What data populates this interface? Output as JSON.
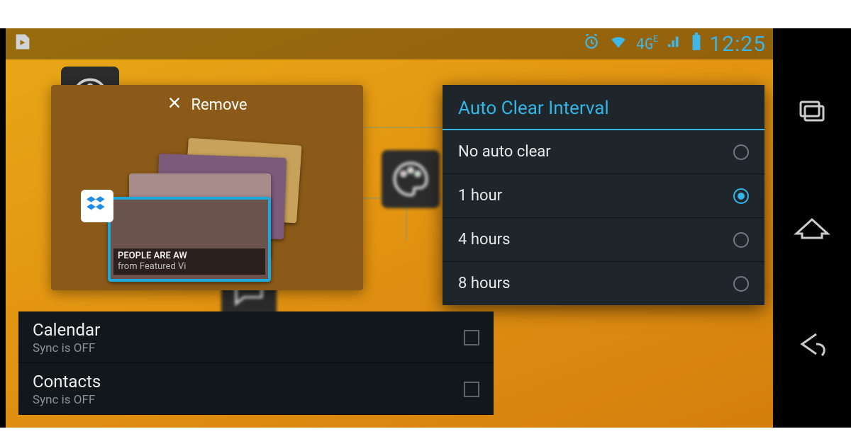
{
  "status": {
    "network_label": "4G",
    "network_sub": "E",
    "time": "12:25"
  },
  "remove_panel": {
    "action_label": "Remove",
    "front_card": {
      "line1": "PEOPLE ARE AW",
      "line2": "from Featured Vi"
    }
  },
  "dialog": {
    "title": "Auto Clear Interval",
    "options": [
      {
        "label": "No auto clear",
        "selected": false
      },
      {
        "label": "1 hour",
        "selected": true
      },
      {
        "label": "4 hours",
        "selected": false
      },
      {
        "label": "8 hours",
        "selected": false
      }
    ]
  },
  "sync_panel": {
    "items": [
      {
        "title": "Calendar",
        "subtitle": "Sync is OFF",
        "checked": false
      },
      {
        "title": "Contacts",
        "subtitle": "Sync is OFF",
        "checked": false
      }
    ]
  }
}
